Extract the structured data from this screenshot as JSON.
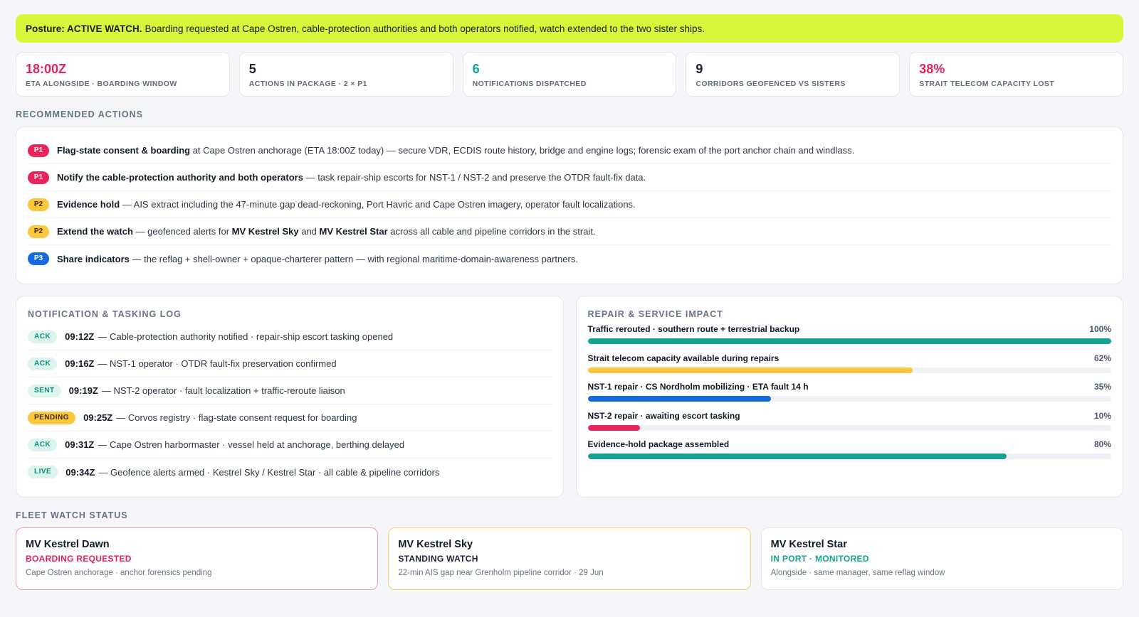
{
  "banner": {
    "label": "Posture: ACTIVE WATCH.",
    "text": "Boarding requested at Cape Ostren, cable-protection authorities and both operators notified, watch extended to the two sister ships."
  },
  "kpis": [
    {
      "value": "18:00Z",
      "label": "ETA ALONGSIDE · BOARDING WINDOW"
    },
    {
      "value": "5",
      "label": "ACTIONS IN PACKAGE · 2 × P1"
    },
    {
      "value": "6",
      "label": "NOTIFICATIONS DISPATCHED"
    },
    {
      "value": "9",
      "label": "CORRIDORS GEOFENCED VS SISTERS"
    },
    {
      "value": "38%",
      "label": "STRAIT TELECOM CAPACITY LOST"
    }
  ],
  "actions_title": "RECOMMENDED ACTIONS",
  "actions": [
    {
      "priority": "P1",
      "bold": "Flag-state consent & boarding",
      "text": " at Cape Ostren anchorage (ETA 18:00Z today) — secure VDR, ECDIS route history, bridge and engine logs; forensic exam of the port anchor chain and windlass."
    },
    {
      "priority": "P1",
      "bold": "Notify the cable-protection authority and both operators",
      "text": " — task repair-ship escorts for NST-1 / NST-2 and preserve the OTDR fault-fix data."
    },
    {
      "priority": "P2",
      "bold": "Evidence hold",
      "text": " — AIS extract including the 47-minute gap dead-reckoning, Port Havric and Cape Ostren imagery, operator fault localizations."
    },
    {
      "priority": "P2",
      "bold": "Extend the watch",
      "text_a": " — geofenced alerts for ",
      "ship_a": "MV Kestrel Sky",
      "text_b": " and ",
      "ship_b": "MV Kestrel Star",
      "text_c": " across all cable and pipeline corridors in the strait."
    },
    {
      "priority": "P3",
      "bold": "Share indicators",
      "text": " — the reflag + shell-owner + opaque-charterer pattern — with regional maritime-domain-awareness partners."
    }
  ],
  "log": {
    "title": "NOTIFICATION & TASKING LOG",
    "items": [
      {
        "tag": "ACK",
        "time": "09:12Z",
        "text": "— Cable-protection authority notified · repair-ship escort tasking opened"
      },
      {
        "tag": "ACK",
        "time": "09:16Z",
        "text": "— NST-1 operator · OTDR fault-fix preservation confirmed"
      },
      {
        "tag": "SENT",
        "time": "09:19Z",
        "text": "— NST-2 operator · fault localization + traffic-reroute liaison"
      },
      {
        "tag": "PENDING",
        "time": "09:25Z",
        "text": "— Corvos registry · flag-state consent request for boarding"
      },
      {
        "tag": "ACK",
        "time": "09:31Z",
        "text": "— Cape Ostren harbormaster · vessel held at anchorage, berthing delayed"
      },
      {
        "tag": "LIVE",
        "time": "09:34Z",
        "text": "— Geofence alerts armed · Kestrel Sky / Kestrel Star · all cable & pipeline corridors"
      }
    ]
  },
  "impact": {
    "title": "REPAIR & SERVICE IMPACT",
    "items": [
      {
        "label": "Traffic rerouted · southern route + terrestrial backup",
        "pct_label": "100%",
        "value": 100,
        "color": "#13a390"
      },
      {
        "label": "Strait telecom capacity available during repairs",
        "pct_label": "62%",
        "value": 62,
        "color": "#fcc63d"
      },
      {
        "label": "NST-1 repair · CS Nordholm mobilizing · ETA fault 14 h",
        "pct_label": "35%",
        "value": 35,
        "color": "#1769e0"
      },
      {
        "label": "NST-2 repair · awaiting escort tasking",
        "pct_label": "10%",
        "value": 10,
        "color": "#e8245c"
      },
      {
        "label": "Evidence-hold package assembled",
        "pct_label": "80%",
        "value": 80,
        "color": "#13a390"
      }
    ]
  },
  "fleet": {
    "title": "FLEET WATCH STATUS",
    "ships": [
      {
        "name": "MV Kestrel Dawn",
        "status": "BOARDING REQUESTED",
        "note": "Cape Ostren anchorage · anchor forensics pending"
      },
      {
        "name": "MV Kestrel Sky",
        "status": "STANDING WATCH",
        "note": "22-min AIS gap near Grenholm pipeline corridor · 29 Jun"
      },
      {
        "name": "MV Kestrel Star",
        "status": "IN PORT · MONITORED",
        "note": "Alongside · same manager, same reflag window"
      }
    ]
  }
}
